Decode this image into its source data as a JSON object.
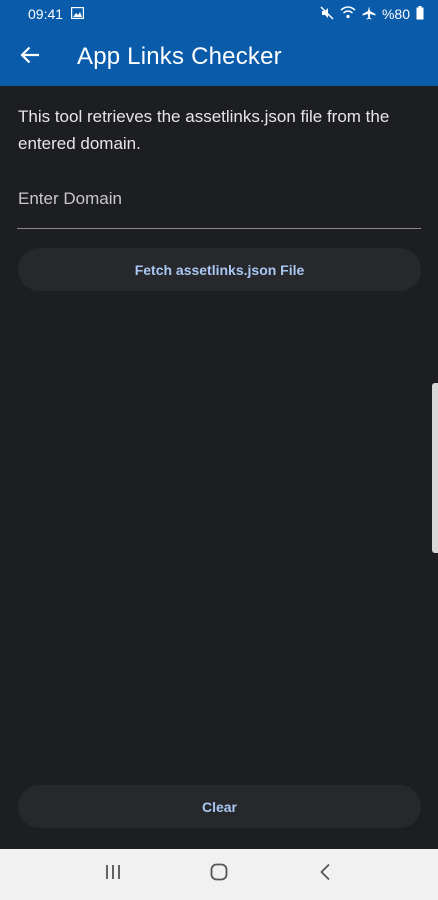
{
  "status_bar": {
    "time": "09:41",
    "battery": "%80",
    "icons": [
      "gallery-icon",
      "mute-icon",
      "wifi-icon",
      "airplane-icon",
      "battery-icon"
    ]
  },
  "app_bar": {
    "title": "App Links Checker",
    "back_icon": "arrow-left-icon"
  },
  "content": {
    "description": "This tool retrieves the assetlinks.json file from the entered domain.",
    "domain_input": {
      "placeholder": "Enter Domain",
      "value": ""
    },
    "fetch_button_label": "Fetch assetlinks.json File",
    "clear_button_label": "Clear"
  },
  "navigation_bar": {
    "icons": [
      "recent-apps-icon",
      "home-icon",
      "back-icon"
    ]
  },
  "colors": {
    "primary": "#0a5cab",
    "background": "#1d1e21",
    "button_bg": "#26282c",
    "button_text": "#a9c7f2"
  }
}
